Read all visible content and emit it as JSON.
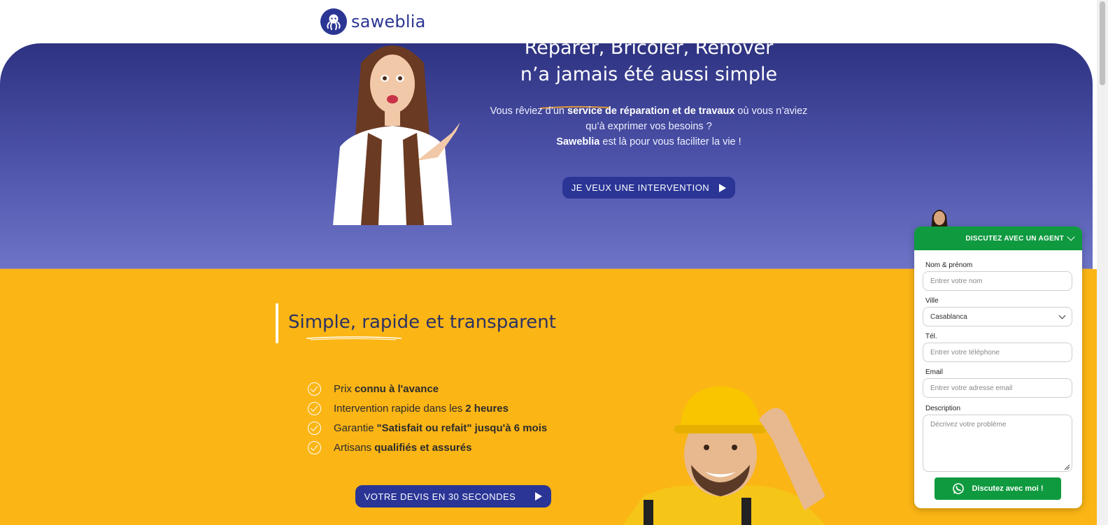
{
  "header": {
    "logo_text": "saweblia",
    "logo_icon": "octopus-icon"
  },
  "hero": {
    "title_line1": "Réparer, Bricoler, Rénover",
    "title_line2": "n’a jamais été aussi simple",
    "desc_part1": "Vous rêviez d’un ",
    "desc_bold1": "service de réparation et de travaux",
    "desc_part2": " où vous n’aviez qu’à exprimer vos besoins ?",
    "desc_bold2": "Saweblia",
    "desc_part3": " est là pour vous faciliter la vie !",
    "cta_label": "JE VEUX UNE INTERVENTION"
  },
  "section": {
    "title": "Simple, rapide et transparent",
    "features": [
      {
        "pre": "Prix",
        "bold": "connu à l'avance",
        "post": ""
      },
      {
        "pre": "Intervention rapide dans les",
        "bold": "2 heures",
        "post": ""
      },
      {
        "pre": "Garantie",
        "bold": "\"Satisfait ou refait\" jusqu'à 6 mois",
        "post": ""
      },
      {
        "pre": "Artisans",
        "bold": "qualifiés et assurés",
        "post": ""
      }
    ],
    "cta_label": "VOTRE DEVIS EN 30 SECONDES"
  },
  "chat": {
    "header_label": "DISCUTEZ AVEC UN AGENT",
    "name_label": "Nom & prénom",
    "name_placeholder": "Entrer votre nom",
    "city_label": "Ville",
    "city_value": "Casablanca",
    "phone_label": "Tél.",
    "phone_placeholder": "Entrer votre téléphone",
    "email_label": "Email",
    "email_placeholder": "Entrer votre adresse email",
    "description_label": "Description",
    "description_placeholder": "Décrivez votre problème",
    "submit_label": "Discutez avec moi !"
  },
  "colors": {
    "brand_blue": "#2a3596",
    "hero_top": "#2e3281",
    "yellow": "#fbb515",
    "whatsapp_green": "#0f9a3f"
  }
}
